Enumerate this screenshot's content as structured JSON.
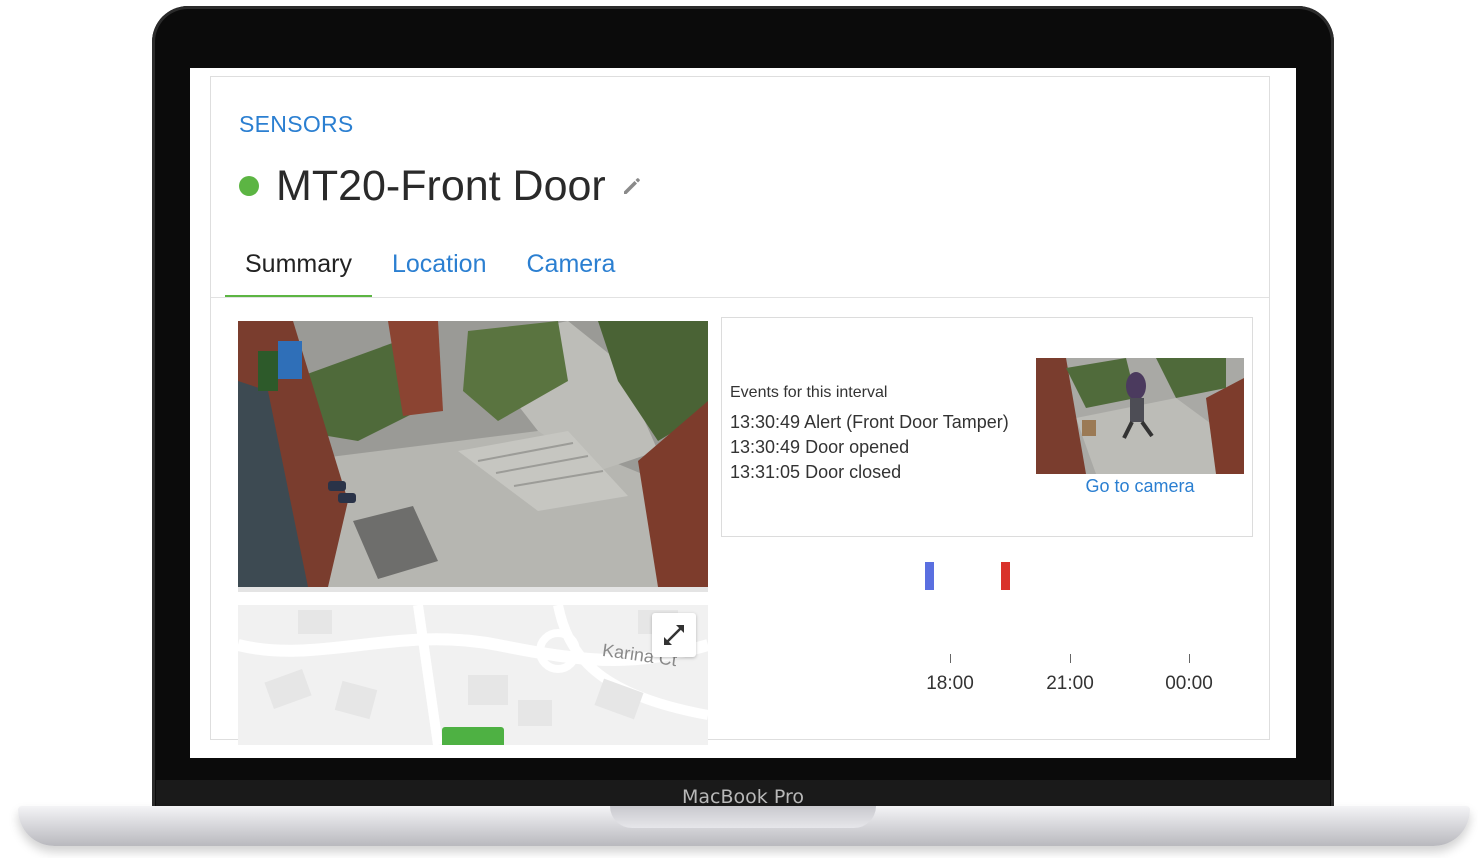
{
  "device": {
    "brand_label": "MacBook Pro"
  },
  "breadcrumb": "SENSORS",
  "sensor": {
    "title": "MT20-Front Door",
    "status_color": "#5cb543",
    "status": "online"
  },
  "tabs": [
    {
      "label": "Summary",
      "active": true
    },
    {
      "label": "Location",
      "active": false
    },
    {
      "label": "Camera",
      "active": false
    }
  ],
  "events": {
    "heading": "Events for this interval",
    "items": [
      "13:30:49 Alert (Front Door Tamper)",
      "13:30:49 Door opened",
      "13:31:05 Door closed"
    ],
    "go_to_camera": "Go to camera"
  },
  "map": {
    "street_label": "Karina Ct"
  },
  "timeline": {
    "ticks": [
      "18:00",
      "21:00",
      "00:00"
    ],
    "markers": [
      {
        "color": "#5a6fe0"
      },
      {
        "color": "#d9322b"
      }
    ]
  },
  "icons": {
    "edit": "pencil-icon",
    "expand": "expand-arrows-icon"
  }
}
